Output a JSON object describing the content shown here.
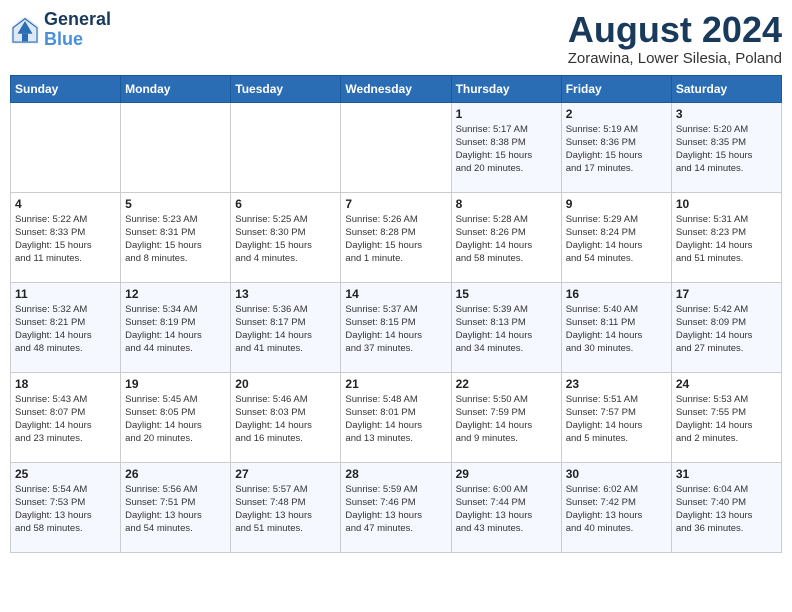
{
  "header": {
    "logo_line1": "General",
    "logo_line2": "Blue",
    "month_year": "August 2024",
    "location": "Zorawina, Lower Silesia, Poland"
  },
  "days_of_week": [
    "Sunday",
    "Monday",
    "Tuesday",
    "Wednesday",
    "Thursday",
    "Friday",
    "Saturday"
  ],
  "weeks": [
    [
      {
        "day": "",
        "info": ""
      },
      {
        "day": "",
        "info": ""
      },
      {
        "day": "",
        "info": ""
      },
      {
        "day": "",
        "info": ""
      },
      {
        "day": "1",
        "info": "Sunrise: 5:17 AM\nSunset: 8:38 PM\nDaylight: 15 hours\nand 20 minutes."
      },
      {
        "day": "2",
        "info": "Sunrise: 5:19 AM\nSunset: 8:36 PM\nDaylight: 15 hours\nand 17 minutes."
      },
      {
        "day": "3",
        "info": "Sunrise: 5:20 AM\nSunset: 8:35 PM\nDaylight: 15 hours\nand 14 minutes."
      }
    ],
    [
      {
        "day": "4",
        "info": "Sunrise: 5:22 AM\nSunset: 8:33 PM\nDaylight: 15 hours\nand 11 minutes."
      },
      {
        "day": "5",
        "info": "Sunrise: 5:23 AM\nSunset: 8:31 PM\nDaylight: 15 hours\nand 8 minutes."
      },
      {
        "day": "6",
        "info": "Sunrise: 5:25 AM\nSunset: 8:30 PM\nDaylight: 15 hours\nand 4 minutes."
      },
      {
        "day": "7",
        "info": "Sunrise: 5:26 AM\nSunset: 8:28 PM\nDaylight: 15 hours\nand 1 minute."
      },
      {
        "day": "8",
        "info": "Sunrise: 5:28 AM\nSunset: 8:26 PM\nDaylight: 14 hours\nand 58 minutes."
      },
      {
        "day": "9",
        "info": "Sunrise: 5:29 AM\nSunset: 8:24 PM\nDaylight: 14 hours\nand 54 minutes."
      },
      {
        "day": "10",
        "info": "Sunrise: 5:31 AM\nSunset: 8:23 PM\nDaylight: 14 hours\nand 51 minutes."
      }
    ],
    [
      {
        "day": "11",
        "info": "Sunrise: 5:32 AM\nSunset: 8:21 PM\nDaylight: 14 hours\nand 48 minutes."
      },
      {
        "day": "12",
        "info": "Sunrise: 5:34 AM\nSunset: 8:19 PM\nDaylight: 14 hours\nand 44 minutes."
      },
      {
        "day": "13",
        "info": "Sunrise: 5:36 AM\nSunset: 8:17 PM\nDaylight: 14 hours\nand 41 minutes."
      },
      {
        "day": "14",
        "info": "Sunrise: 5:37 AM\nSunset: 8:15 PM\nDaylight: 14 hours\nand 37 minutes."
      },
      {
        "day": "15",
        "info": "Sunrise: 5:39 AM\nSunset: 8:13 PM\nDaylight: 14 hours\nand 34 minutes."
      },
      {
        "day": "16",
        "info": "Sunrise: 5:40 AM\nSunset: 8:11 PM\nDaylight: 14 hours\nand 30 minutes."
      },
      {
        "day": "17",
        "info": "Sunrise: 5:42 AM\nSunset: 8:09 PM\nDaylight: 14 hours\nand 27 minutes."
      }
    ],
    [
      {
        "day": "18",
        "info": "Sunrise: 5:43 AM\nSunset: 8:07 PM\nDaylight: 14 hours\nand 23 minutes."
      },
      {
        "day": "19",
        "info": "Sunrise: 5:45 AM\nSunset: 8:05 PM\nDaylight: 14 hours\nand 20 minutes."
      },
      {
        "day": "20",
        "info": "Sunrise: 5:46 AM\nSunset: 8:03 PM\nDaylight: 14 hours\nand 16 minutes."
      },
      {
        "day": "21",
        "info": "Sunrise: 5:48 AM\nSunset: 8:01 PM\nDaylight: 14 hours\nand 13 minutes."
      },
      {
        "day": "22",
        "info": "Sunrise: 5:50 AM\nSunset: 7:59 PM\nDaylight: 14 hours\nand 9 minutes."
      },
      {
        "day": "23",
        "info": "Sunrise: 5:51 AM\nSunset: 7:57 PM\nDaylight: 14 hours\nand 5 minutes."
      },
      {
        "day": "24",
        "info": "Sunrise: 5:53 AM\nSunset: 7:55 PM\nDaylight: 14 hours\nand 2 minutes."
      }
    ],
    [
      {
        "day": "25",
        "info": "Sunrise: 5:54 AM\nSunset: 7:53 PM\nDaylight: 13 hours\nand 58 minutes."
      },
      {
        "day": "26",
        "info": "Sunrise: 5:56 AM\nSunset: 7:51 PM\nDaylight: 13 hours\nand 54 minutes."
      },
      {
        "day": "27",
        "info": "Sunrise: 5:57 AM\nSunset: 7:48 PM\nDaylight: 13 hours\nand 51 minutes."
      },
      {
        "day": "28",
        "info": "Sunrise: 5:59 AM\nSunset: 7:46 PM\nDaylight: 13 hours\nand 47 minutes."
      },
      {
        "day": "29",
        "info": "Sunrise: 6:00 AM\nSunset: 7:44 PM\nDaylight: 13 hours\nand 43 minutes."
      },
      {
        "day": "30",
        "info": "Sunrise: 6:02 AM\nSunset: 7:42 PM\nDaylight: 13 hours\nand 40 minutes."
      },
      {
        "day": "31",
        "info": "Sunrise: 6:04 AM\nSunset: 7:40 PM\nDaylight: 13 hours\nand 36 minutes."
      }
    ]
  ]
}
